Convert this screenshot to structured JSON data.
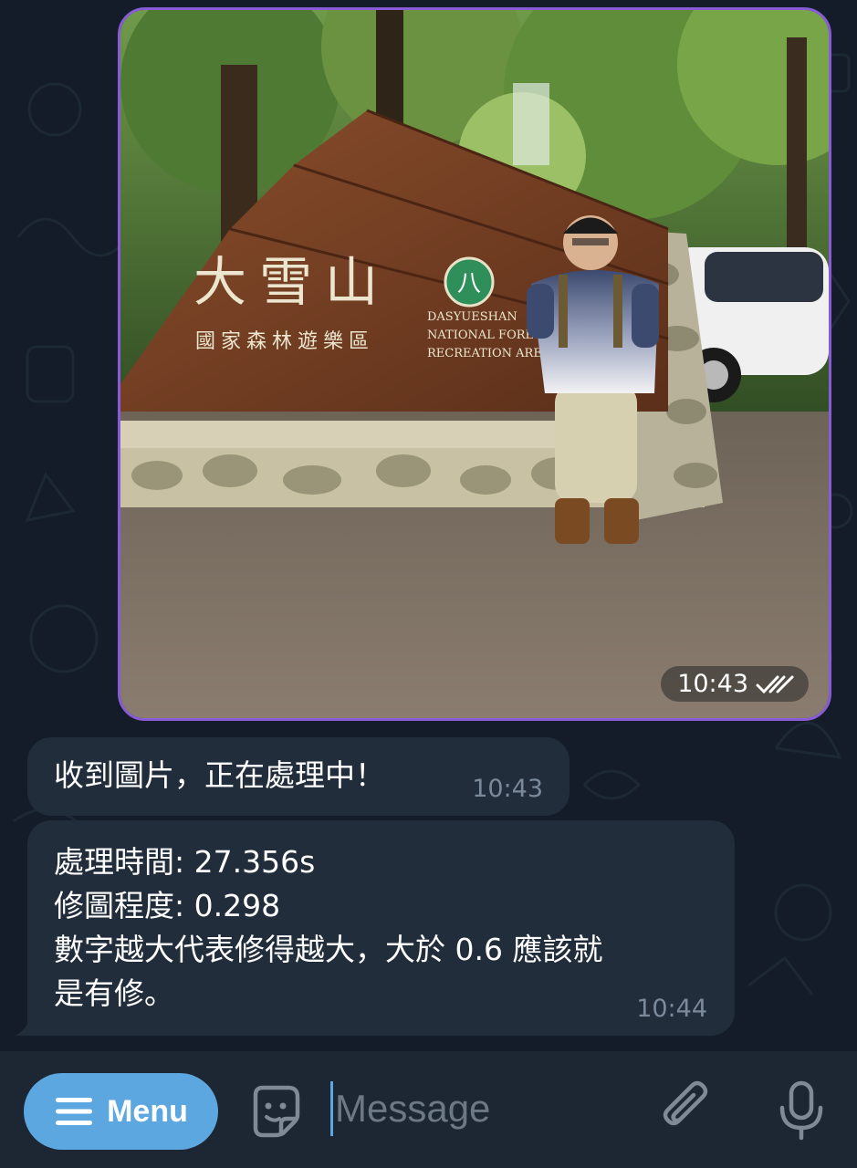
{
  "photo_message": {
    "time": "10:43",
    "status": "double-check-icon",
    "sign_title": "大雪山",
    "sign_subtitle": "國家森林遊樂區",
    "sign_en_line1": "DASYUESHAN",
    "sign_en_line2": "NATIONAL FOREST",
    "sign_en_line3": "RECREATION AREA",
    "sign_logo": "八"
  },
  "messages": [
    {
      "lines": [
        "收到圖片，正在處理中！"
      ],
      "time": "10:43"
    },
    {
      "lines": [
        "處理時間: 27.356s",
        "修圖程度: 0.298",
        "數字越大代表修得越大，大於 0.6 應該就",
        "是有修。"
      ],
      "time": "10:44"
    }
  ],
  "composer": {
    "menu_label": "Menu",
    "placeholder": "Message",
    "icons": [
      "menu-icon",
      "sticker-icon",
      "attach-icon",
      "mic-icon"
    ]
  },
  "colors": {
    "accent": "#5ca7e0",
    "bubble": "#212d3b",
    "photo_border": "#8a5bd6",
    "background": "#131c28"
  }
}
